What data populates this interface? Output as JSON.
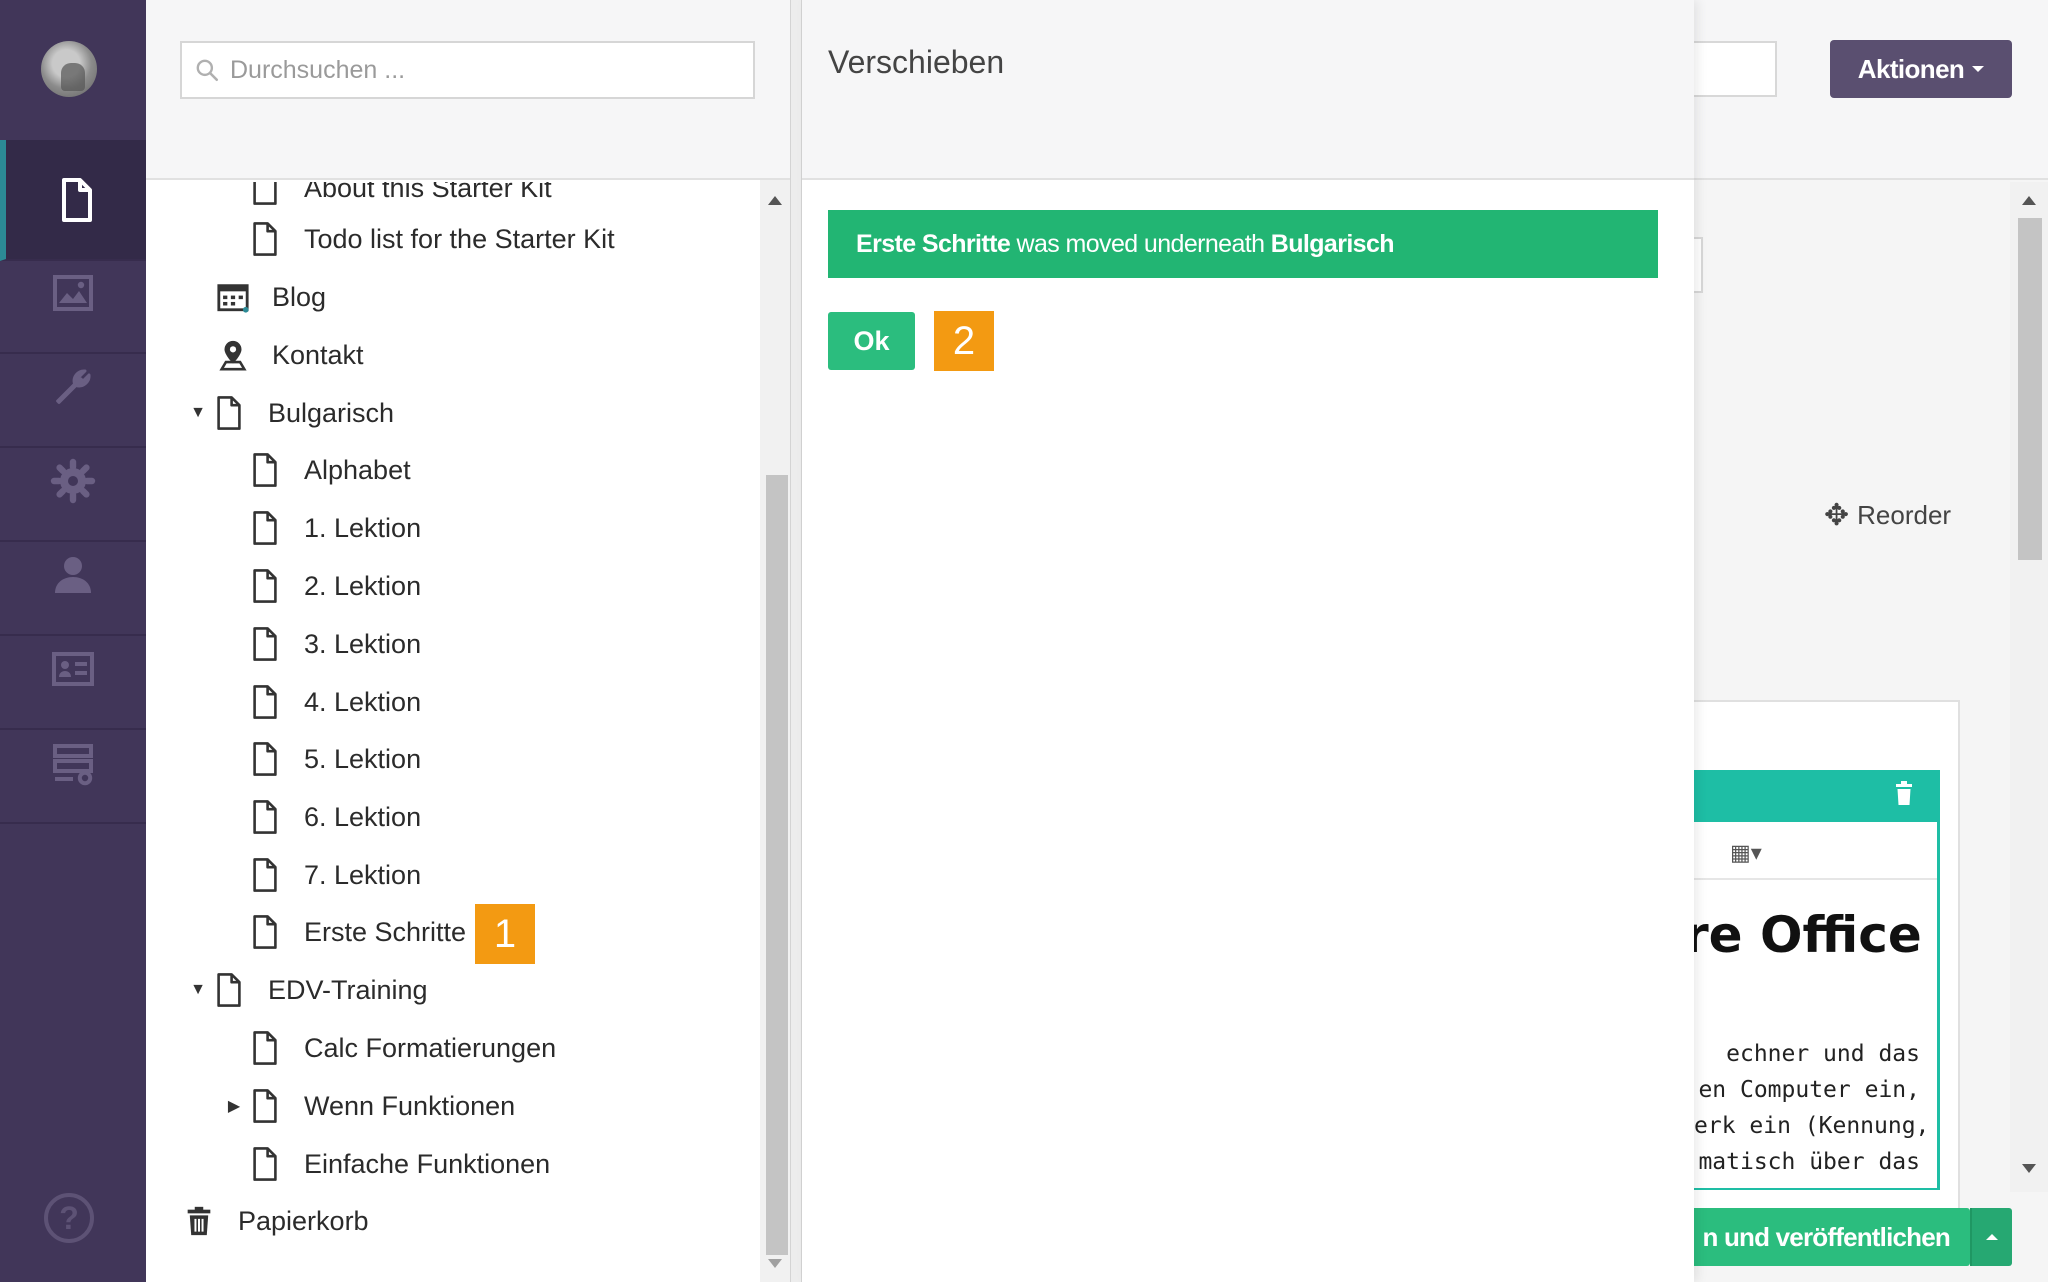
{
  "search": {
    "placeholder": "Durchsuchen ..."
  },
  "rail": {
    "items": [
      {
        "icon": "document-icon",
        "active": true
      },
      {
        "icon": "image-icon"
      },
      {
        "icon": "wrench-icon"
      },
      {
        "icon": "gear-icon"
      },
      {
        "icon": "user-icon"
      },
      {
        "icon": "member-card-icon"
      },
      {
        "icon": "forms-icon"
      }
    ],
    "help_icon": "help-icon",
    "help_glyph": "?"
  },
  "tree": {
    "items": [
      {
        "label": "About this Starter Kit",
        "icon": "document-icon"
      },
      {
        "label": "Todo list for the Starter Kit",
        "icon": "document-icon"
      },
      {
        "label": "Blog",
        "icon": "calendar-icon"
      },
      {
        "label": "Kontakt",
        "icon": "map-pin-icon"
      },
      {
        "label": "Bulgarisch",
        "icon": "document-icon",
        "expanded": true
      },
      {
        "label": "Alphabet",
        "icon": "document-icon"
      },
      {
        "label": "1. Lektion",
        "icon": "document-icon"
      },
      {
        "label": "2. Lektion",
        "icon": "document-icon"
      },
      {
        "label": "3. Lektion",
        "icon": "document-icon"
      },
      {
        "label": "4. Lektion",
        "icon": "document-icon"
      },
      {
        "label": "5. Lektion",
        "icon": "document-icon"
      },
      {
        "label": "6. Lektion",
        "icon": "document-icon"
      },
      {
        "label": "7. Lektion",
        "icon": "document-icon"
      },
      {
        "label": "Erste Schritte",
        "icon": "document-icon"
      },
      {
        "label": "EDV-Training",
        "icon": "document-icon",
        "expanded": true
      },
      {
        "label": "Calc Formatierungen",
        "icon": "document-icon"
      },
      {
        "label": "Wenn Funktionen",
        "icon": "document-icon",
        "collapsed": true
      },
      {
        "label": "Einfache Funktionen",
        "icon": "document-icon"
      },
      {
        "label": "Papierkorb",
        "icon": "trash-icon"
      }
    ]
  },
  "dialog": {
    "title": "Verschieben",
    "alert": {
      "item": "Erste Schritte",
      "middle": " was moved underneath ",
      "target": "Bulgarisch"
    },
    "ok_label": "Ok"
  },
  "markers": {
    "first": "1",
    "second": "2"
  },
  "background": {
    "actions_label": "Aktionen",
    "reorder_label": "Reorder",
    "editor_heading": "re Office",
    "editor_lines": [
      "echner und das",
      "en Computer ein,",
      "erk ein (Kennung,",
      "matisch über das"
    ],
    "publish_label": "n und veröffentlichen"
  },
  "colors": {
    "rail": "#413659",
    "success": "#22b573",
    "button_green": "#2bbd7e",
    "marker": "#f39a12",
    "actions": "#5a4f70",
    "teal": "#1ebea5"
  }
}
